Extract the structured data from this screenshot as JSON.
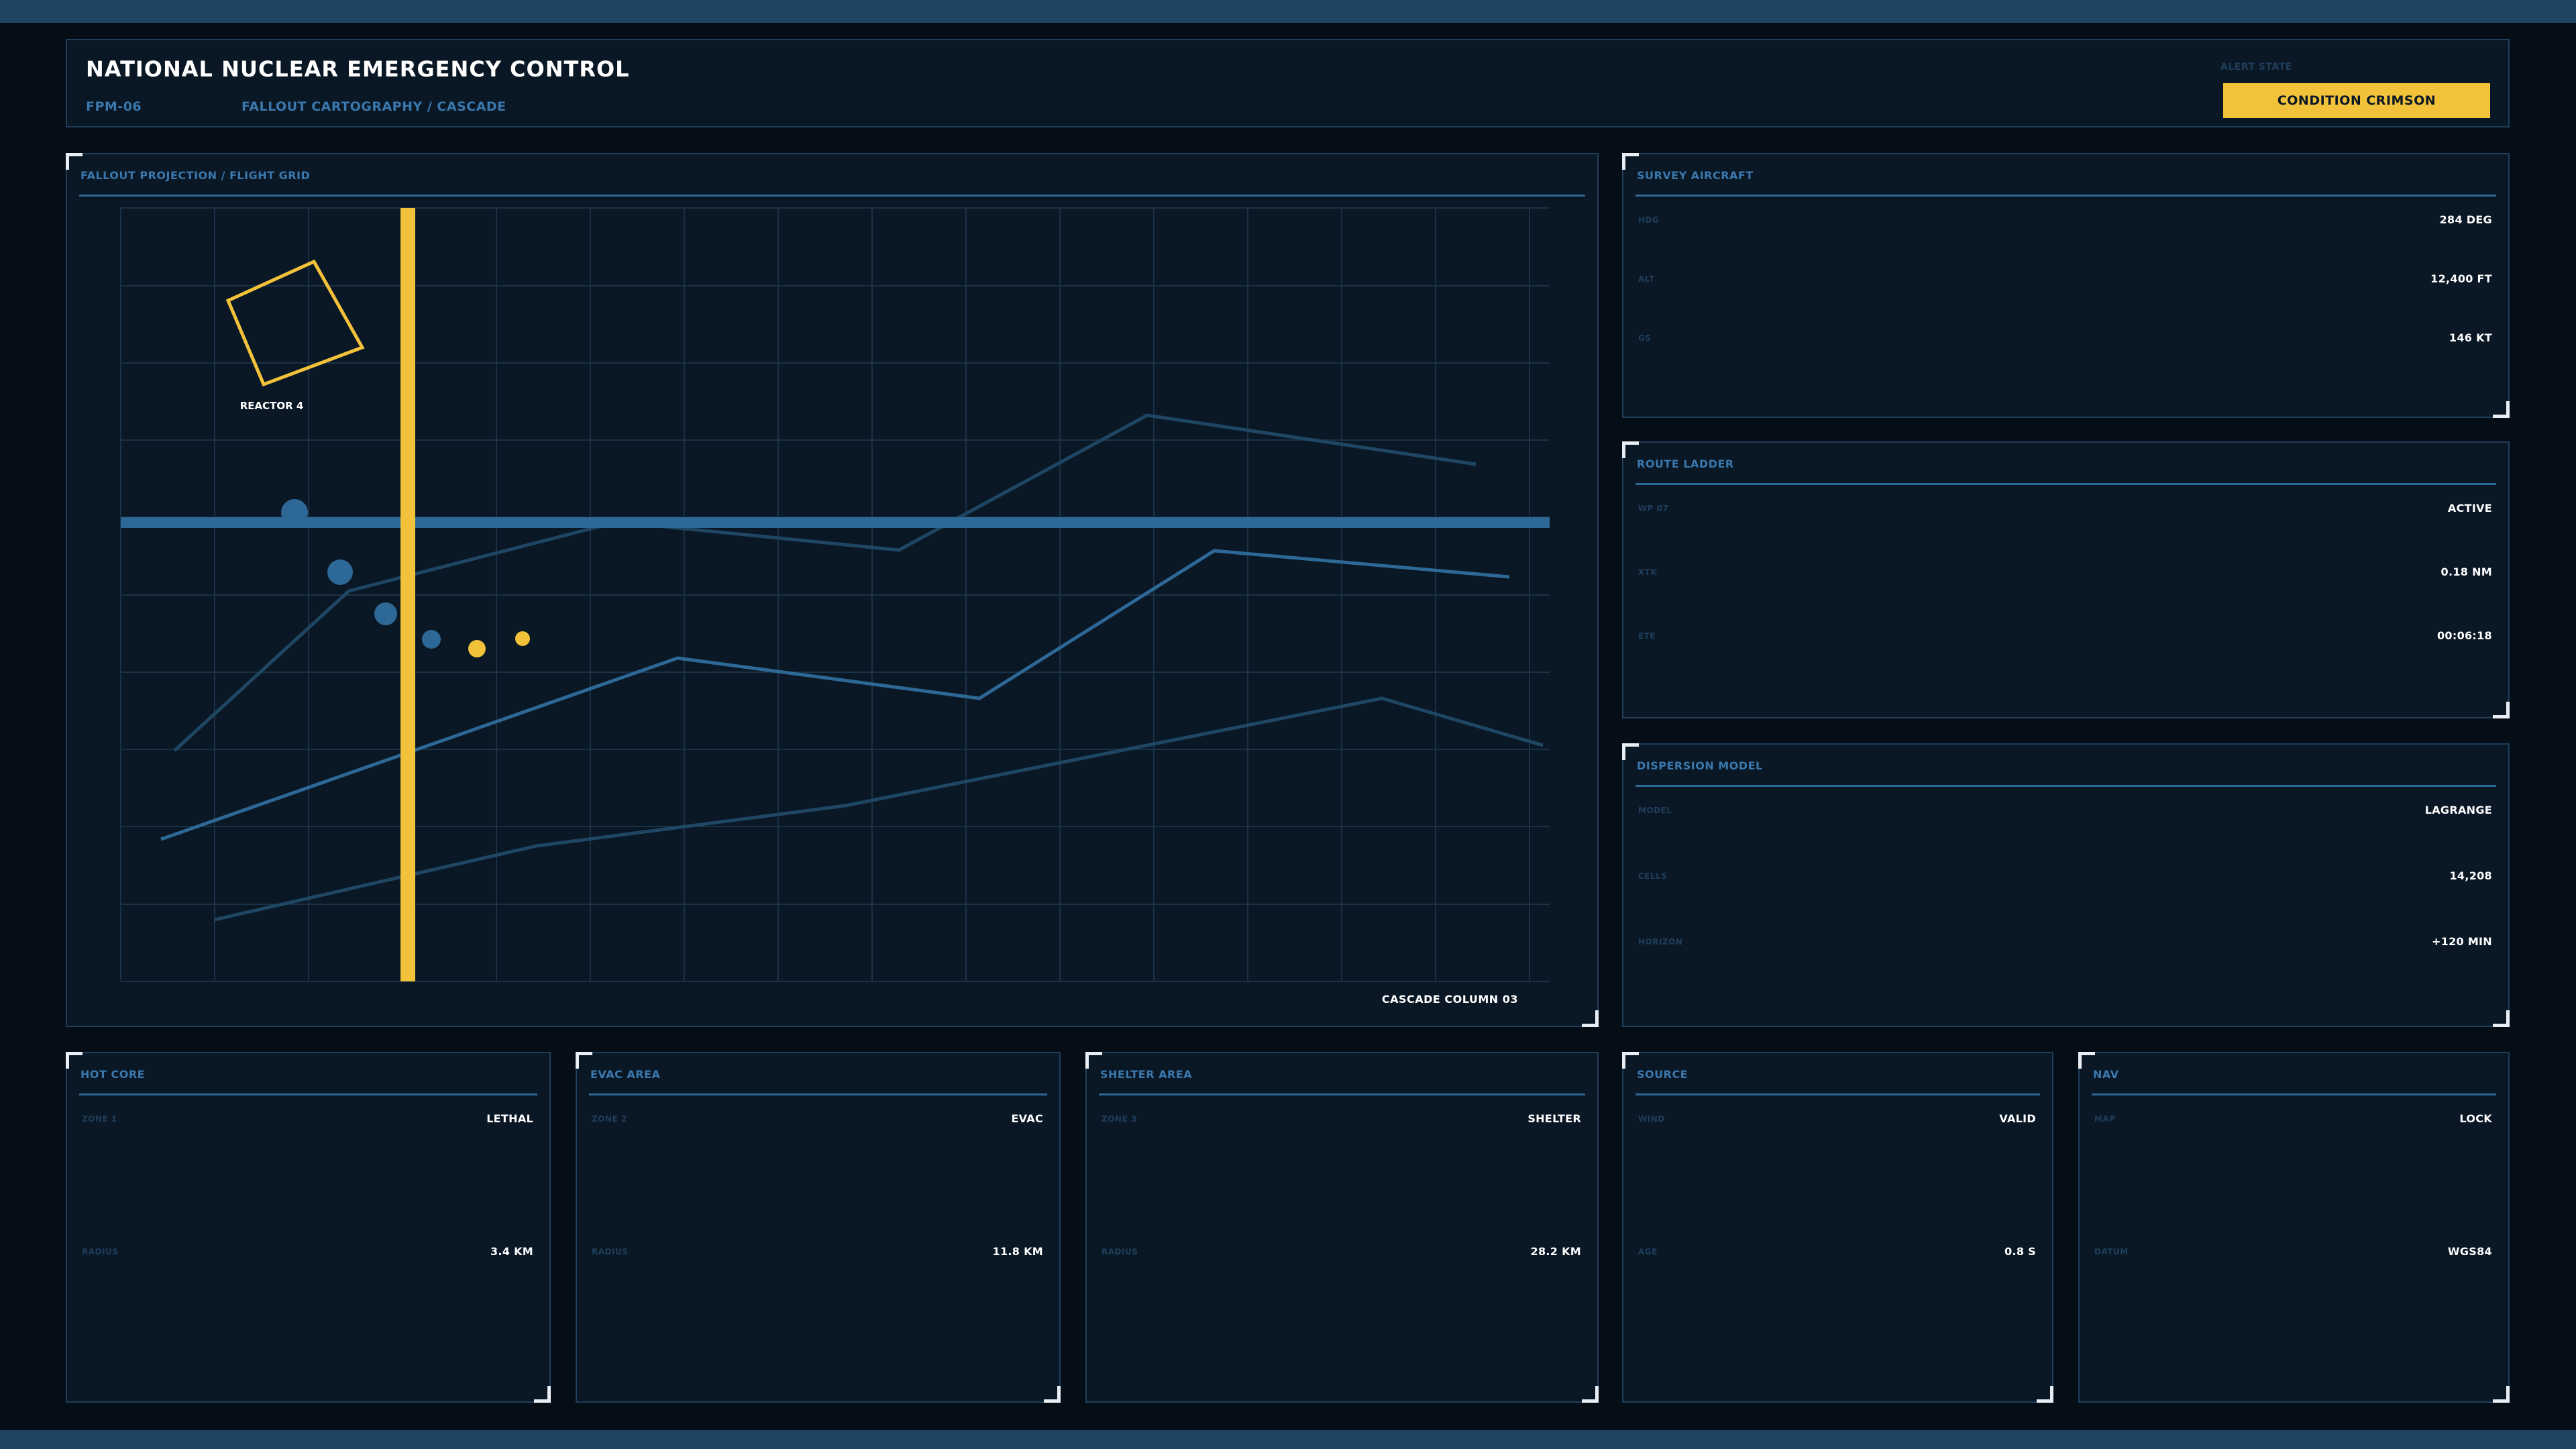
{
  "header": {
    "title": "NATIONAL NUCLEAR EMERGENCY CONTROL",
    "code": "FPM-06",
    "subtitle": "FALLOUT CARTOGRAPHY / CASCADE",
    "alert_label": "ALERT STATE",
    "alert_value": "CONDITION CRIMSON"
  },
  "map": {
    "title": "FALLOUT PROJECTION / FLIGHT GRID",
    "reactor_label": "REACTOR 4",
    "cascade_label": "CASCADE COLUMN 03"
  },
  "survey": {
    "title": "SURVEY AIRCRAFT",
    "rows": [
      {
        "label": "HDG",
        "value": "284 DEG"
      },
      {
        "label": "ALT",
        "value": "12,400 FT"
      },
      {
        "label": "GS",
        "value": "146 KT"
      }
    ]
  },
  "route": {
    "title": "ROUTE LADDER",
    "rows": [
      {
        "label": "WP 07",
        "value": "ACTIVE"
      },
      {
        "label": "XTK",
        "value": "0.18 NM"
      },
      {
        "label": "ETE",
        "value": "00:06:18"
      }
    ]
  },
  "dispersion": {
    "title": "DISPERSION MODEL",
    "rows": [
      {
        "label": "MODEL",
        "value": "LAGRANGE"
      },
      {
        "label": "CELLS",
        "value": "14,208"
      },
      {
        "label": "HORIZON",
        "value": "+120 MIN"
      }
    ]
  },
  "hot_core": {
    "title": "HOT CORE",
    "rows": [
      {
        "label": "ZONE 1",
        "value": "LETHAL"
      },
      {
        "label": "RADIUS",
        "value": "3.4 KM"
      }
    ]
  },
  "evac": {
    "title": "EVAC AREA",
    "rows": [
      {
        "label": "ZONE 2",
        "value": "EVAC"
      },
      {
        "label": "RADIUS",
        "value": "11.8 KM"
      }
    ]
  },
  "shelter": {
    "title": "SHELTER AREA",
    "rows": [
      {
        "label": "ZONE 3",
        "value": "SHELTER"
      },
      {
        "label": "RADIUS",
        "value": "28.2 KM"
      }
    ]
  },
  "source": {
    "title": "SOURCE",
    "rows": [
      {
        "label": "WIND",
        "value": "VALID"
      },
      {
        "label": "AGE",
        "value": "0.8 S"
      }
    ]
  },
  "nav": {
    "title": "NAV",
    "rows": [
      {
        "label": "MAP",
        "value": "LOCK"
      },
      {
        "label": "DATUM",
        "value": "WGS84"
      }
    ]
  },
  "colors": {
    "accent": "#f2c23a",
    "primary_blue": "#2d6896",
    "panel": "#0a1725",
    "background": "#050d16"
  }
}
